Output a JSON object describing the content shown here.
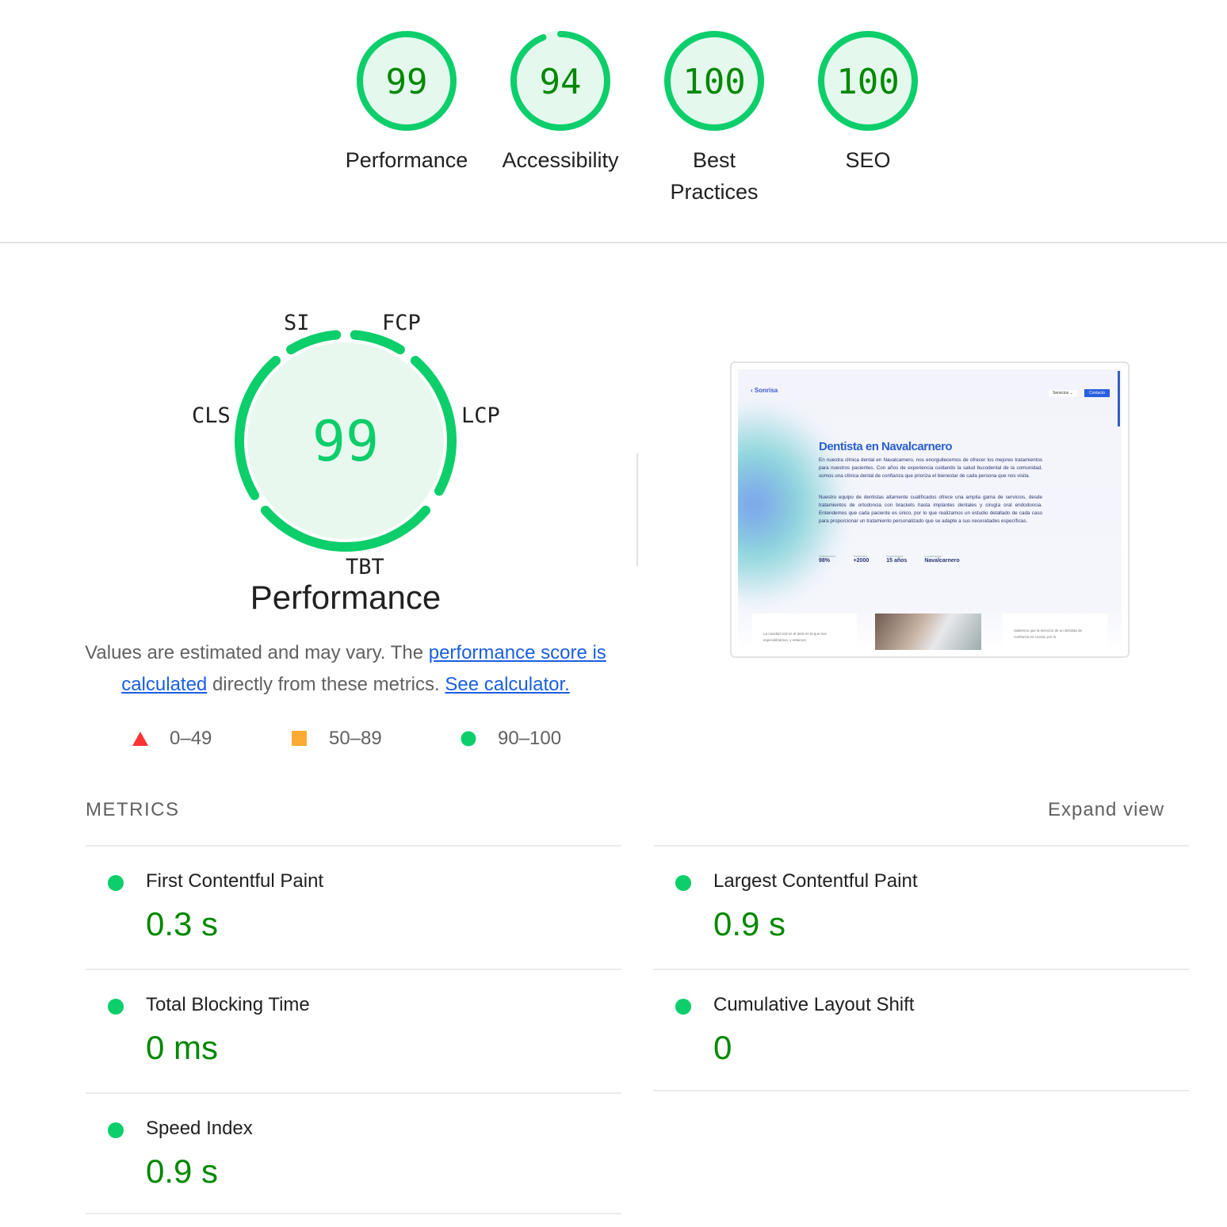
{
  "categories": [
    {
      "score": "99",
      "label": "Performance",
      "fraction": 0.99
    },
    {
      "score": "94",
      "label": "Accessibility",
      "fraction": 0.94
    },
    {
      "score": "100",
      "label": "Best Practices",
      "fraction": 1.0
    },
    {
      "score": "100",
      "label": "SEO",
      "fraction": 1.0
    }
  ],
  "performance": {
    "score": "99",
    "title": "Performance",
    "gauge_labels": {
      "si": "SI",
      "fcp": "FCP",
      "lcp": "LCP",
      "tbt": "TBT",
      "cls": "CLS"
    },
    "desc_1": "Values are estimated and may vary. The ",
    "link_1": "performance score is calculated",
    "desc_2": " directly from these metrics. ",
    "link_2": "See calculator.",
    "legend": [
      {
        "range": "0–49",
        "shape": "triangle",
        "color": "#ff3333"
      },
      {
        "range": "50–89",
        "shape": "square",
        "color": "#ffaa33"
      },
      {
        "range": "90–100",
        "shape": "circle",
        "color": "#0cce6b"
      }
    ]
  },
  "screenshot": {
    "brand": "Sonrisa",
    "nav_services": "Servicios ⌄",
    "nav_contact": "Contacto",
    "heading": "Dentista en Navalcarnero",
    "para1": "En nuestra clínica dental en Navalcarnero, nos enorgullecemos de ofrecer los mejores tratamientos para nuestros pacientes. Con años de experiencia cuidando la salud bucodental de la comunidad, somos una clínica dental de confianza que prioriza el bienestar de cada persona que nos visita.",
    "para2": "Nuestro equipo de dentistas altamente cualificados ofrece una amplia gama de servicios, desde tratamientos de ortodoncia con brackets hasta implantes dentales y cirugía oral endodoncia. Entendemos que cada paciente es único, por lo que realizamos un estudio detallado de cada caso para proporcionar un tratamiento personalizado que se adapte a sus necesidades específicas.",
    "stats": [
      {
        "k": "Satisfacción",
        "v": "98%"
      },
      {
        "k": "Pacientes",
        "v": "+2000"
      },
      {
        "k": "Experiencia",
        "v": "15 años"
      },
      {
        "k": "Localización",
        "v": "Navalcarnero"
      }
    ],
    "card1": "La cavidad oral es el área en la que nos especializamos, y estamos",
    "card3": "Sabemos que la elección de un dentista de confianza es crucial, por lo"
  },
  "metrics": {
    "heading": "METRICS",
    "expand": "Expand view",
    "items": [
      {
        "name": "First Contentful Paint",
        "value": "0.3 s",
        "status": "good"
      },
      {
        "name": "Largest Contentful Paint",
        "value": "0.9 s",
        "status": "good"
      },
      {
        "name": "Total Blocking Time",
        "value": "0 ms",
        "status": "good"
      },
      {
        "name": "Cumulative Layout Shift",
        "value": "0",
        "status": "good"
      },
      {
        "name": "Speed Index",
        "value": "0.9 s",
        "status": "good"
      }
    ]
  },
  "colors": {
    "pass": "#0cce6b",
    "pass_text": "#008800",
    "pass_bg": "#e5f8ee",
    "link": "#1a5fe0"
  }
}
